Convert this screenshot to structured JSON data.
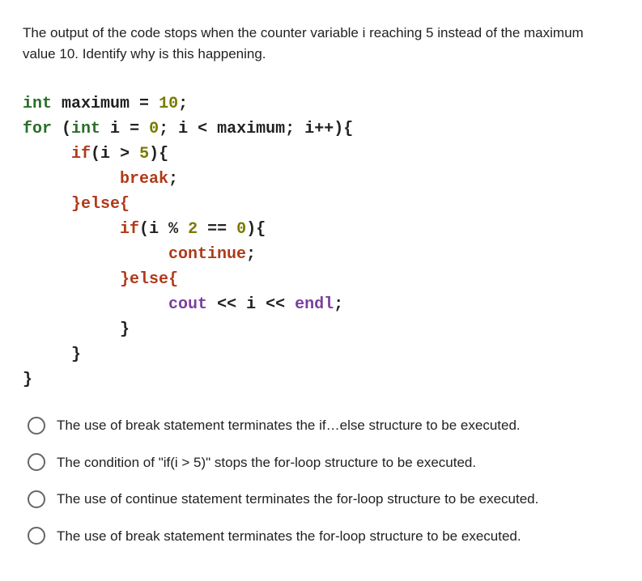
{
  "question": "The output of the code stops when the counter variable i reaching 5 instead of the maximum value 10. Identify why is this happening.",
  "code": {
    "l1": {
      "kw1": "int",
      "id": " maximum ",
      "op1": "=",
      "sp1": " ",
      "num": "10",
      "op2": ";"
    },
    "l2": {
      "kw1": "for",
      "p": " (",
      "kw2": "int",
      "id": " i ",
      "op1": "=",
      "sp1": " ",
      "num1": "0",
      "op2": ";",
      "id2": " i ",
      "op3": "<",
      "id3": " maximum",
      "op4": ";",
      "id4": " i",
      "op5": "++",
      ")": ")",
      "brace": "{"
    },
    "l3": {
      "indent": "     ",
      "kw": "if",
      "p": "(",
      "id": "i ",
      "op": ">",
      "sp": " ",
      "num": "5",
      "p2": ")",
      "brace": "{"
    },
    "l4": {
      "indent": "          ",
      "kw": "break",
      "op": ";"
    },
    "l5": {
      "indent": "     ",
      "cb": "}",
      "kw": "else",
      "ob": "{"
    },
    "l6": {
      "indent": "          ",
      "kw": "if",
      "p": "(",
      "id": "i ",
      "op1": "%",
      "sp1": " ",
      "num": "2",
      "sp2": " ",
      "op2": "==",
      "sp3": " ",
      "num2": "0",
      "p2": ")",
      "brace": "{"
    },
    "l7": {
      "indent": "               ",
      "kw": "continue",
      "op": ";"
    },
    "l8": {
      "indent": "          ",
      "cb": "}",
      "kw": "else",
      "ob": "{"
    },
    "l9": {
      "indent": "               ",
      "io1": "cout",
      "sp1": " ",
      "op1": "<<",
      "sp2": " ",
      "id": "i",
      "sp3": " ",
      "op2": "<<",
      "sp4": " ",
      "io2": "endl",
      "op3": ";"
    },
    "l10": {
      "indent": "          ",
      "cb": "}"
    },
    "l11": {
      "indent": "     ",
      "cb": "}"
    },
    "l12": {
      "cb": "}"
    }
  },
  "options": [
    "The use of break statement terminates the if…else structure to be executed.",
    "The condition of \"if(i > 5)\" stops the for-loop structure to be executed.",
    "The use of continue statement terminates the for-loop structure to be executed.",
    "The use of break statement terminates the for-loop structure to be executed."
  ]
}
